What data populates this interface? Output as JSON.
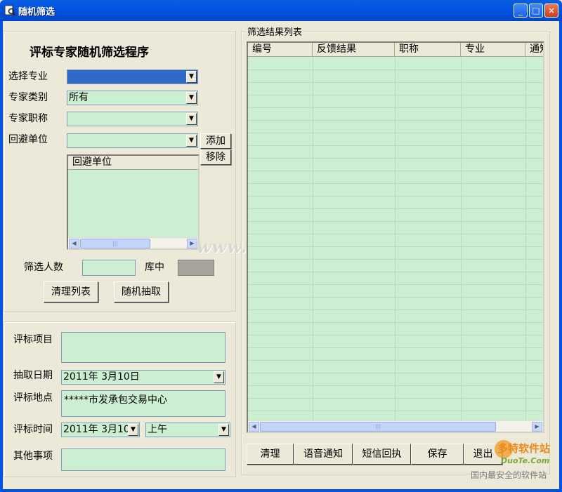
{
  "window": {
    "title": "随机筛选",
    "minimize": "_",
    "maximize": "□",
    "close": "×"
  },
  "filter": {
    "heading": "评标专家随机筛选程序",
    "major_label": "选择专业",
    "major_value": "",
    "category_label": "专家类别",
    "category_value": "所有",
    "title_label": "专家职称",
    "title_value": "",
    "avoid_label": "回避单位",
    "avoid_value": "",
    "add_btn": "添加",
    "remove_btn": "移除",
    "avoid_list_header": "回避单位",
    "count_label": "筛选人数",
    "count_value": "",
    "stock_label": "库中",
    "stock_value": "",
    "clear_btn": "清理列表",
    "random_btn": "随机抽取"
  },
  "project": {
    "item_label": "评标项目",
    "item_value": "",
    "date_label": "抽取日期",
    "date_value": "2011年 3月10日",
    "place_label": "评标地点",
    "place_value": "*****市发承包交易中心",
    "time_label": "评标时间",
    "time_date": "2011年 3月10",
    "time_period": "上午",
    "other_label": "其他事项",
    "other_value": ""
  },
  "results": {
    "group_label": "筛选结果列表",
    "columns": [
      "编号",
      "反馈结果",
      "职称",
      "专业",
      "通知"
    ]
  },
  "actions": {
    "clean": "清理",
    "voice": "语音通知",
    "sms": "短信回执",
    "save": "保存",
    "exit": "退出"
  },
  "watermarks": {
    "center": "www.DuoTe.com",
    "corner_brand": "多特软件站",
    "corner_domain": "DuoTe.Com",
    "corner_tagline": "国内最安全的软件站"
  },
  "icons": {
    "app": "search-app-icon",
    "dropdown": "chevron-down-icon"
  }
}
